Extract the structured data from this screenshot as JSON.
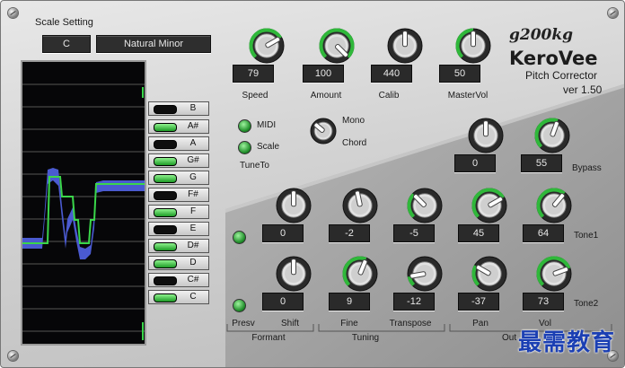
{
  "header": {
    "scale_setting_label": "Scale Setting",
    "key_value": "C",
    "scale_value": "Natural Minor"
  },
  "brand": {
    "logo": "g200kg",
    "title": "KeroVee",
    "subtitle": "Pitch Corrector",
    "version": "ver 1.50"
  },
  "notes": [
    {
      "label": "B",
      "on": false
    },
    {
      "label": "A#",
      "on": true
    },
    {
      "label": "A",
      "on": false
    },
    {
      "label": "G#",
      "on": true
    },
    {
      "label": "G",
      "on": true
    },
    {
      "label": "F#",
      "on": false
    },
    {
      "label": "F",
      "on": true
    },
    {
      "label": "E",
      "on": false
    },
    {
      "label": "D#",
      "on": true
    },
    {
      "label": "D",
      "on": true
    },
    {
      "label": "C#",
      "on": false
    },
    {
      "label": "C",
      "on": true
    }
  ],
  "top_knobs": [
    {
      "label": "Speed",
      "value": "79"
    },
    {
      "label": "Amount",
      "value": "100"
    },
    {
      "label": "Calib",
      "value": "440"
    },
    {
      "label": "MasterVol",
      "value": "50"
    }
  ],
  "tuneto": {
    "label": "TuneTo",
    "midi_label": "MIDI",
    "scale_label": "Scale",
    "mono_label": "Mono",
    "chord_label": "Chord"
  },
  "bypass": {
    "label": "Bypass",
    "knobs": [
      {
        "value": "0"
      },
      {
        "value": "55"
      }
    ]
  },
  "tone1": {
    "label": "Tone1",
    "knobs": [
      {
        "value": "0"
      },
      {
        "value": "-2"
      },
      {
        "value": "-5"
      },
      {
        "value": "45"
      },
      {
        "value": "64"
      }
    ]
  },
  "tone2": {
    "label": "Tone2",
    "knobs": [
      {
        "value": "0"
      },
      {
        "value": "9"
      },
      {
        "value": "-12"
      },
      {
        "value": "-37"
      },
      {
        "value": "73"
      }
    ]
  },
  "columns": {
    "presv": "Presv",
    "shift": "Shift",
    "fine": "Fine",
    "transpose": "Transpose",
    "pan": "Pan",
    "vol": "Vol"
  },
  "groups": {
    "formant": "Formant",
    "tuning": "Tuning",
    "output": "Out"
  },
  "watermark": "最需教育",
  "colors": {
    "accent_green": "#2fb83a",
    "pitch_blue": "#4a5ad0",
    "pitch_green": "#3ad64a",
    "display_bg": "#2a2a2a"
  }
}
